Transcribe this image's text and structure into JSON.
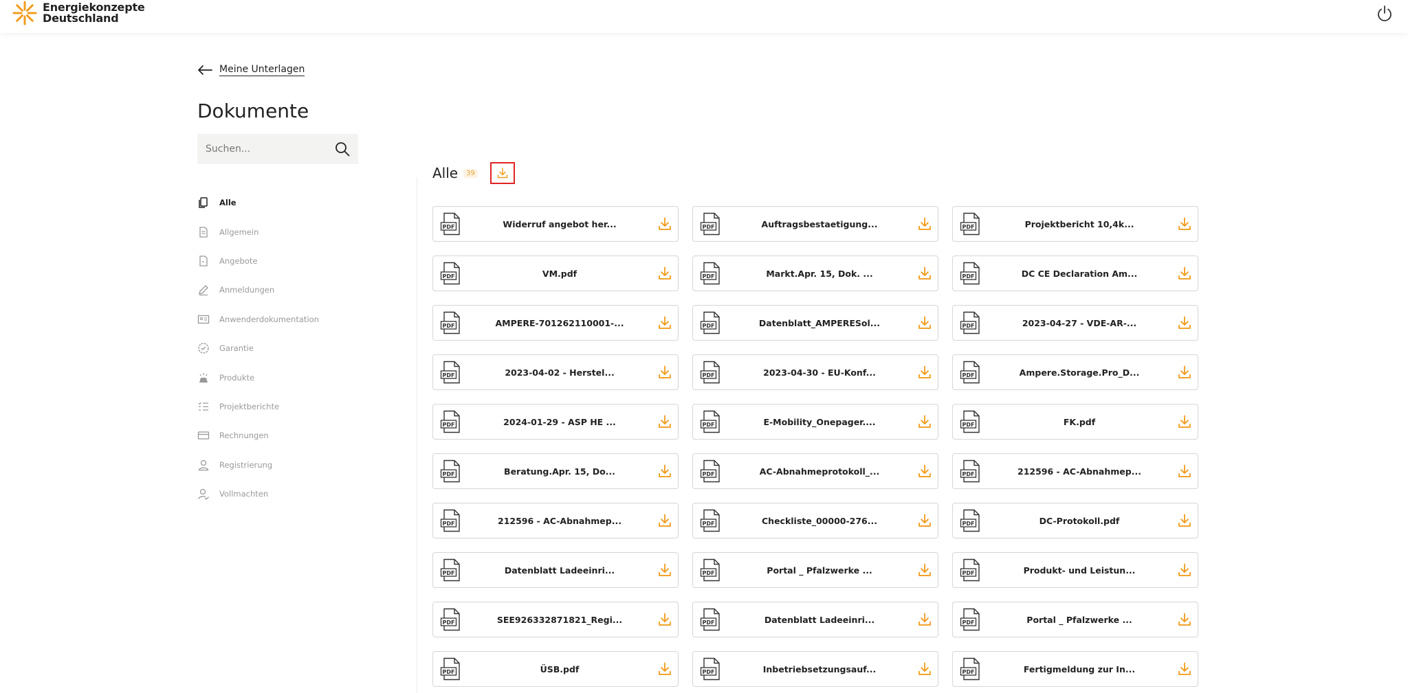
{
  "brand": {
    "line1": "Energiekonzepte",
    "line2": "Deutschland",
    "accent": "#F39C1E"
  },
  "header": {
    "power_icon": "power-icon"
  },
  "back": {
    "label": "Meine Unterlagen"
  },
  "page_title": "Dokumente",
  "search": {
    "placeholder": "Suchen...",
    "value": ""
  },
  "nav": [
    {
      "label": "Alle",
      "icon": "copy-icon",
      "active": true
    },
    {
      "label": "Allgemein",
      "icon": "document-icon"
    },
    {
      "label": "Angebote",
      "icon": "document-icon"
    },
    {
      "label": "Anmeldungen",
      "icon": "pen-icon"
    },
    {
      "label": "Anwenderdokumentation",
      "icon": "id-card-icon"
    },
    {
      "label": "Garantie",
      "icon": "shield-check-icon"
    },
    {
      "label": "Produkte",
      "icon": "solar-panel-icon"
    },
    {
      "label": "Projektberichte",
      "icon": "list-icon"
    },
    {
      "label": "Rechnungen",
      "icon": "credit-card-icon"
    },
    {
      "label": "Registrierung",
      "icon": "user-icon"
    },
    {
      "label": "Vollmachten",
      "icon": "user-check-icon"
    }
  ],
  "section": {
    "title": "Alle",
    "count": "39"
  },
  "documents": [
    "Widerruf angebot her...",
    "Auftragsbestaetigung...",
    "Projektbericht 10,4k...",
    "VM.pdf",
    "Markt.Apr. 15, Dok. ...",
    "DC CE Declaration Am...",
    "AMPERE-701262110001-...",
    "Datenblatt_AMPERESol...",
    "2023-04-27 - VDE-AR-...",
    "2023-04-02 - Herstel...",
    "2023-04-30 - EU-Konf...",
    "Ampere.Storage.Pro_D...",
    "2024-01-29 - ASP HE ...",
    "E-Mobility_Onepager....",
    "FK.pdf",
    "Beratung.Apr. 15, Do...",
    "AC-Abnahmeprotokoll_...",
    "212596 - AC-Abnahmep...",
    "212596 - AC-Abnahmep...",
    "Checkliste_00000-276...",
    "DC-Protokoll.pdf",
    "Datenblatt Ladeeinri...",
    "Portal _ Pfalzwerke ...",
    "Produkt- und Leistun...",
    "SEE926332871821_Regi...",
    "Datenblatt Ladeeinri...",
    "Portal _ Pfalzwerke ...",
    "ÜSB.pdf",
    "Inbetriebsetzungsauf...",
    "Fertigmeldung zur In..."
  ]
}
